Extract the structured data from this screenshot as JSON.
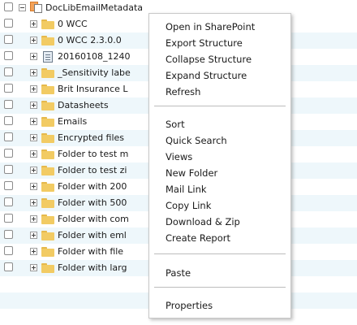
{
  "tree": {
    "root": {
      "label": "DocLibEmailMetadata"
    },
    "items": [
      {
        "label": "0 WCC",
        "icon": "folder-icon"
      },
      {
        "label": "0 WCC 2.3.0.0",
        "icon": "folder-icon"
      },
      {
        "label": "20160108_1240",
        "icon": "document-icon"
      },
      {
        "label": "_Sensitivity labe",
        "icon": "folder-icon"
      },
      {
        "label": "Brit Insurance L",
        "icon": "folder-icon"
      },
      {
        "label": "Datasheets",
        "icon": "folder-icon"
      },
      {
        "label": "Emails",
        "icon": "folder-icon"
      },
      {
        "label": "Encrypted files",
        "icon": "folder-icon"
      },
      {
        "label": "Folder to test m",
        "icon": "folder-icon"
      },
      {
        "label": "Folder to test zi",
        "icon": "folder-icon"
      },
      {
        "label": "Folder with 200",
        "icon": "folder-icon"
      },
      {
        "label": "Folder with 500",
        "icon": "folder-icon"
      },
      {
        "label": "Folder with com",
        "icon": "folder-icon"
      },
      {
        "label": "Folder with eml",
        "icon": "folder-icon"
      },
      {
        "label": "Folder with file",
        "icon": "folder-icon"
      },
      {
        "label": "Folder with larg",
        "icon": "folder-icon"
      }
    ]
  },
  "context_menu": {
    "group1": [
      "Open in SharePoint",
      "Export Structure",
      "Collapse Structure",
      "Expand Structure",
      "Refresh"
    ],
    "group2": [
      "Sort",
      "Quick Search",
      "Views",
      "New Folder",
      "Mail Link",
      "Copy Link",
      "Download & Zip",
      "Create Report"
    ],
    "group3": [
      "Paste"
    ],
    "group4": [
      "Properties"
    ]
  },
  "colors": {
    "row_alt": "#eef7fb",
    "folder": "#f2cb63"
  }
}
